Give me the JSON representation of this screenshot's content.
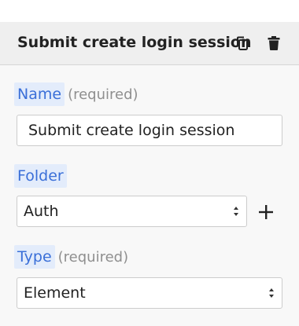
{
  "header": {
    "title": "Submit create login session",
    "copy_icon": "copy-icon",
    "delete_icon": "trash-icon"
  },
  "fields": {
    "name": {
      "label": "Name",
      "hint": "(required)",
      "value": "Submit create login session"
    },
    "folder": {
      "label": "Folder",
      "selected": "Auth",
      "add_icon": "plus-icon"
    },
    "type": {
      "label": "Type",
      "hint": "(required)",
      "selected": "Element"
    }
  },
  "colors": {
    "label_text": "#3a6fd8",
    "label_background": "#e3ecfb",
    "hint_text": "#8f8f8f",
    "header_background": "#efefef",
    "panel_background": "#f8f8f8"
  }
}
